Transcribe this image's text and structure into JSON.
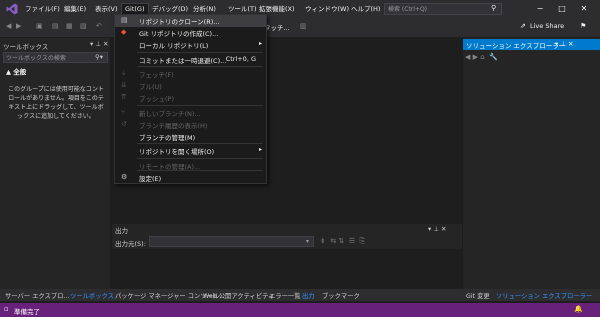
{
  "menubar": {
    "items": [
      "ファイル(F)",
      "編集(E)",
      "表示(V)",
      "Git(G)",
      "デバッグ(D)",
      "分析(N)",
      "ツール(T)",
      "拡張機能(X)",
      "ウィンドウ(W)",
      "ヘルプ(H)"
    ],
    "active_index": 3
  },
  "search": {
    "placeholder": "検索 (Ctrl+Q)"
  },
  "toolbar": {
    "live_share": "Live Share",
    "partial_label": "タッチ..."
  },
  "toolbox": {
    "title": "ツールボックス",
    "search_placeholder": "ツールボックスの検索",
    "group": "▲ 全般",
    "empty_message": "このグループには使用可能なコントロールがありません。項目をこのテキスト上にドラッグして、ツールボックスに追加してください。"
  },
  "git_menu": {
    "items": [
      {
        "label": "リポジトリのクローン(R)...",
        "icon": "clone-icon",
        "shortcut": "",
        "submenu": false,
        "disabled": false,
        "hover": true
      },
      {
        "label": "Git リポジトリの作成(C)...",
        "icon": "git-create-icon",
        "shortcut": "",
        "submenu": false,
        "disabled": false,
        "hover": false
      },
      {
        "label": "ローカル リポジトリ(L)",
        "icon": "",
        "shortcut": "",
        "submenu": true,
        "disabled": false,
        "hover": false
      },
      {
        "label": "コミットまたは一時退避(C)...",
        "icon": "",
        "shortcut": "Ctrl+0, G",
        "submenu": false,
        "disabled": false,
        "hover": false
      },
      {
        "label": "フェッチ(F)",
        "icon": "fetch-icon",
        "shortcut": "",
        "submenu": false,
        "disabled": true,
        "hover": false
      },
      {
        "label": "プル(U)",
        "icon": "pull-icon",
        "shortcut": "",
        "submenu": false,
        "disabled": true,
        "hover": false
      },
      {
        "label": "プッシュ(P)",
        "icon": "push-icon",
        "shortcut": "",
        "submenu": false,
        "disabled": true,
        "hover": false
      },
      {
        "label": "新しいブランチ(N)...",
        "icon": "branch-icon",
        "shortcut": "",
        "submenu": false,
        "disabled": true,
        "hover": false
      },
      {
        "label": "ブランチ履歴の表示(H)",
        "icon": "history-icon",
        "shortcut": "",
        "submenu": false,
        "disabled": true,
        "hover": false
      },
      {
        "label": "ブランチの管理(M)",
        "icon": "",
        "shortcut": "",
        "submenu": false,
        "disabled": false,
        "hover": false
      },
      {
        "label": "リポジトリを開く場所(O)",
        "icon": "",
        "shortcut": "",
        "submenu": true,
        "disabled": false,
        "hover": false
      },
      {
        "label": "リモートの管理(A)...",
        "icon": "",
        "shortcut": "",
        "submenu": false,
        "disabled": true,
        "hover": false
      },
      {
        "label": "設定(E)",
        "icon": "gear-icon",
        "shortcut": "",
        "submenu": false,
        "disabled": false,
        "hover": false
      }
    ]
  },
  "output": {
    "title": "出力",
    "source_label": "出力元(S):"
  },
  "solution_explorer": {
    "title": "ソリューション エクスプローラー"
  },
  "bottom_tabs": {
    "left": [
      "サーバー エクスプロ...",
      "ツールボックス",
      "パッケージ マネージャー コンソール",
      "Web 公開アクティビティ",
      "エラー一覧",
      "出力",
      "ブックマーク"
    ],
    "right": [
      "Git 変更",
      "ソリューション エクスプローラー"
    ]
  },
  "status": {
    "text": "準備完了"
  },
  "colors": {
    "accent": "#007acc",
    "status_bar": "#68217a",
    "vs_logo": "#865fc5"
  }
}
